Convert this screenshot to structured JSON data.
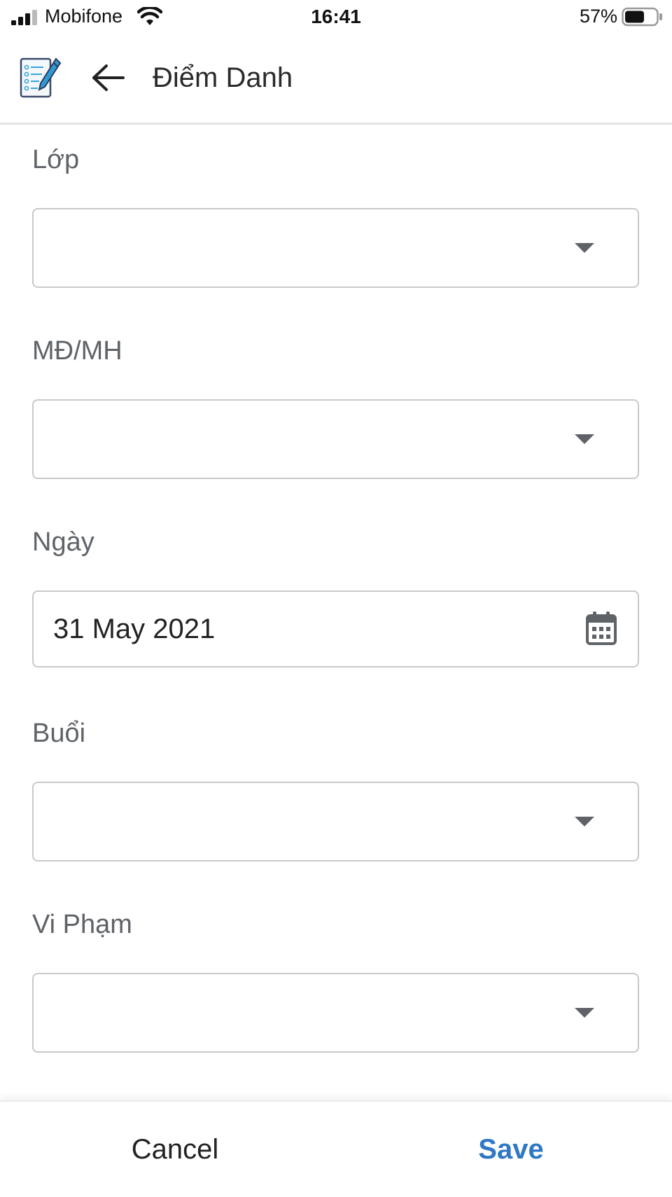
{
  "status_bar": {
    "carrier": "Mobifone",
    "time": "16:41",
    "battery_percent": "57%",
    "icons": [
      "signal-icon",
      "wifi-icon",
      "battery-icon"
    ]
  },
  "header": {
    "logo_icon": "checklist-pencil-icon",
    "back_icon": "arrow-left-icon",
    "title": "Điểm Danh"
  },
  "form": {
    "fields": [
      {
        "label": "Lớp",
        "type": "dropdown",
        "value": ""
      },
      {
        "label": "MĐ/MH",
        "type": "dropdown",
        "value": ""
      },
      {
        "label": "Ngày",
        "type": "date",
        "value": "31 May 2021"
      },
      {
        "label": "Buổi",
        "type": "dropdown",
        "value": ""
      },
      {
        "label": "Vi Phạm",
        "type": "dropdown",
        "value": ""
      }
    ]
  },
  "actions": {
    "cancel_label": "Cancel",
    "save_label": "Save"
  },
  "colors": {
    "accent": "#2f78c4",
    "label": "#5f6368",
    "border": "#c9c9c9"
  }
}
